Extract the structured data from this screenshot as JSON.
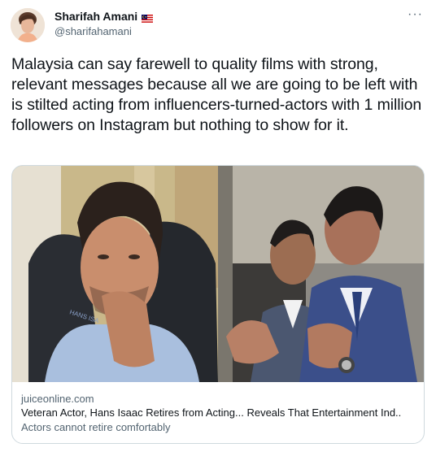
{
  "author": {
    "display_name": "Sharifah Amani",
    "flag": "malaysia-flag",
    "handle": "@sharifahamani"
  },
  "menu": {
    "more_label": "···"
  },
  "tweet": {
    "text": "Malaysia can say farewell to quality films with strong, relevant messages because all we are going to be left with is stilted acting from influencers-turned-actors with 1 million followers on Instagram but nothing to show for it."
  },
  "link_card": {
    "domain": "juiceonline.com",
    "title": "Veteran Actor, Hans Isaac Retires from Acting... Reveals That Entertainment Ind..",
    "description": "Actors cannot retire comfortably",
    "chair_text": "HANS ISA"
  }
}
